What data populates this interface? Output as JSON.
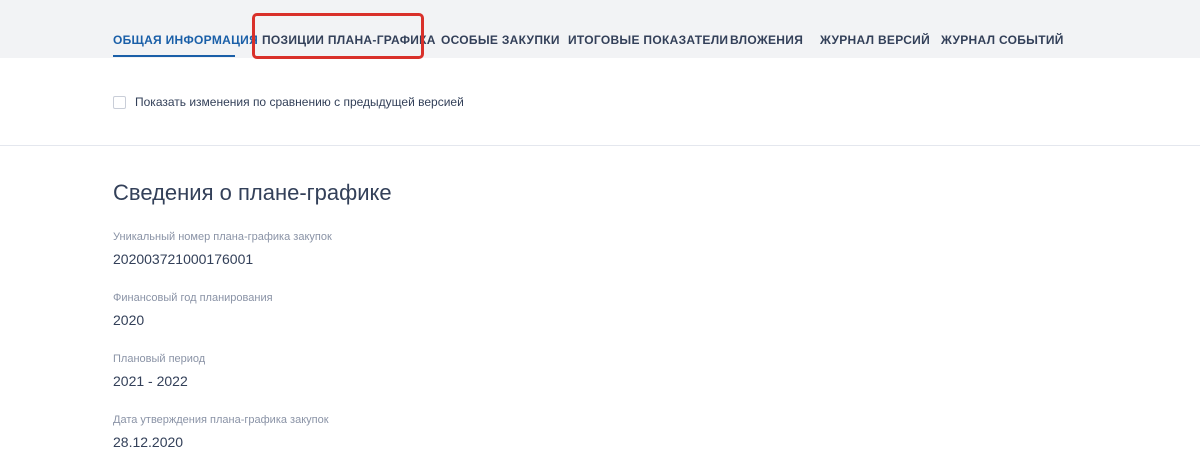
{
  "tabs": [
    {
      "label": "ОБЩАЯ ИНФОРМАЦИЯ",
      "active": true
    },
    {
      "label": "ПОЗИЦИИ ПЛАНА-ГРАФИКА",
      "highlighted": true
    },
    {
      "label": "ОСОБЫЕ ЗАКУПКИ"
    },
    {
      "label": "ИТОГОВЫЕ ПОКАЗАТЕЛИ"
    },
    {
      "label": "ВЛОЖЕНИЯ"
    },
    {
      "label": "ЖУРНАЛ ВЕРСИЙ"
    },
    {
      "label": "ЖУРНАЛ СОБЫТИЙ"
    }
  ],
  "compare_checkbox": {
    "label": "Показать изменения по сравнению с предыдущей версией",
    "checked": false
  },
  "section": {
    "title": "Сведения о плане-графике",
    "fields": [
      {
        "label": "Уникальный номер плана-графика закупок",
        "value": "202003721000176001"
      },
      {
        "label": "Финансовый год планирования",
        "value": "2020"
      },
      {
        "label": "Плановый период",
        "value": "2021 - 2022"
      },
      {
        "label": "Дата утверждения плана-графика закупок",
        "value": "28.12.2020"
      }
    ]
  },
  "colors": {
    "active_tab": "#1a5fa8",
    "highlight_border": "#d9302a",
    "tabbar_bg": "#f2f3f5",
    "text": "#334059",
    "muted": "#8a93a6"
  }
}
